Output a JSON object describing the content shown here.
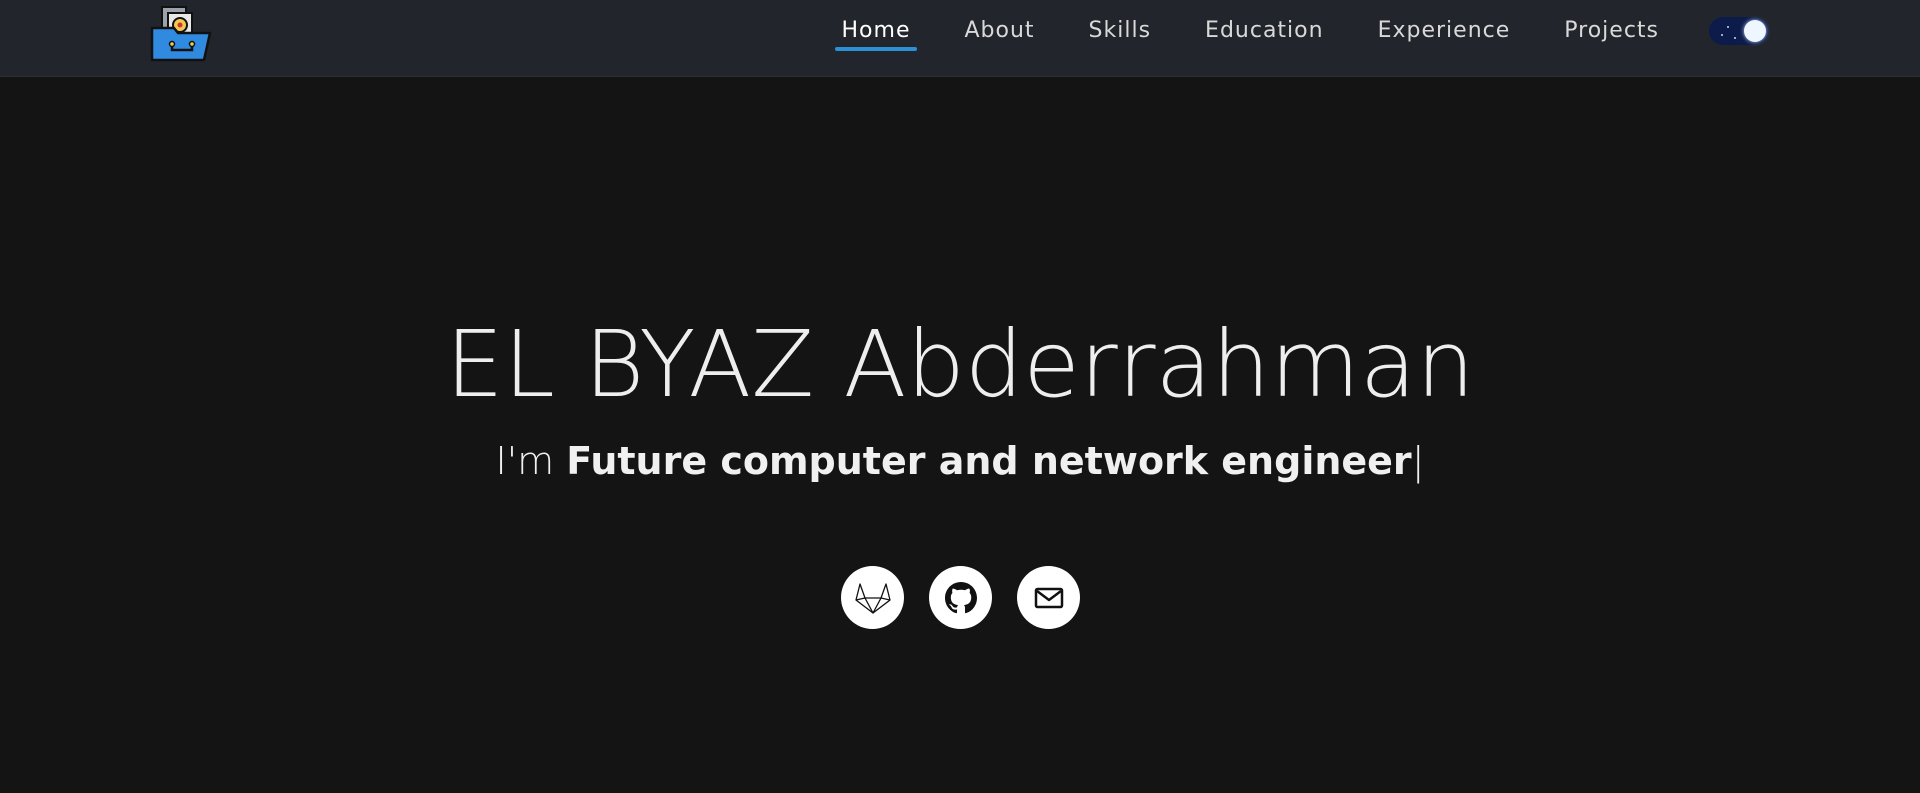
{
  "nav": {
    "items": [
      {
        "label": "Home",
        "active": true
      },
      {
        "label": "About",
        "active": false
      },
      {
        "label": "Skills",
        "active": false
      },
      {
        "label": "Education",
        "active": false
      },
      {
        "label": "Experience",
        "active": false
      },
      {
        "label": "Projects",
        "active": false
      }
    ],
    "theme_toggle": {
      "mode": "dark",
      "icon": "moon-toggle-icon"
    }
  },
  "hero": {
    "name": "EL BYAZ Abderrahman",
    "subtitle_prefix": "I'm ",
    "subtitle_typed": "Future computer and network engineer",
    "cursor": "|"
  },
  "socials": [
    {
      "icon": "gitlab-icon"
    },
    {
      "icon": "github-icon"
    },
    {
      "icon": "mail-icon"
    }
  ],
  "colors": {
    "background": "#141414",
    "navbar": "#22252b",
    "accent": "#2e8fd9",
    "text": "#eeeeee",
    "toggle": "#0d1b4b"
  }
}
